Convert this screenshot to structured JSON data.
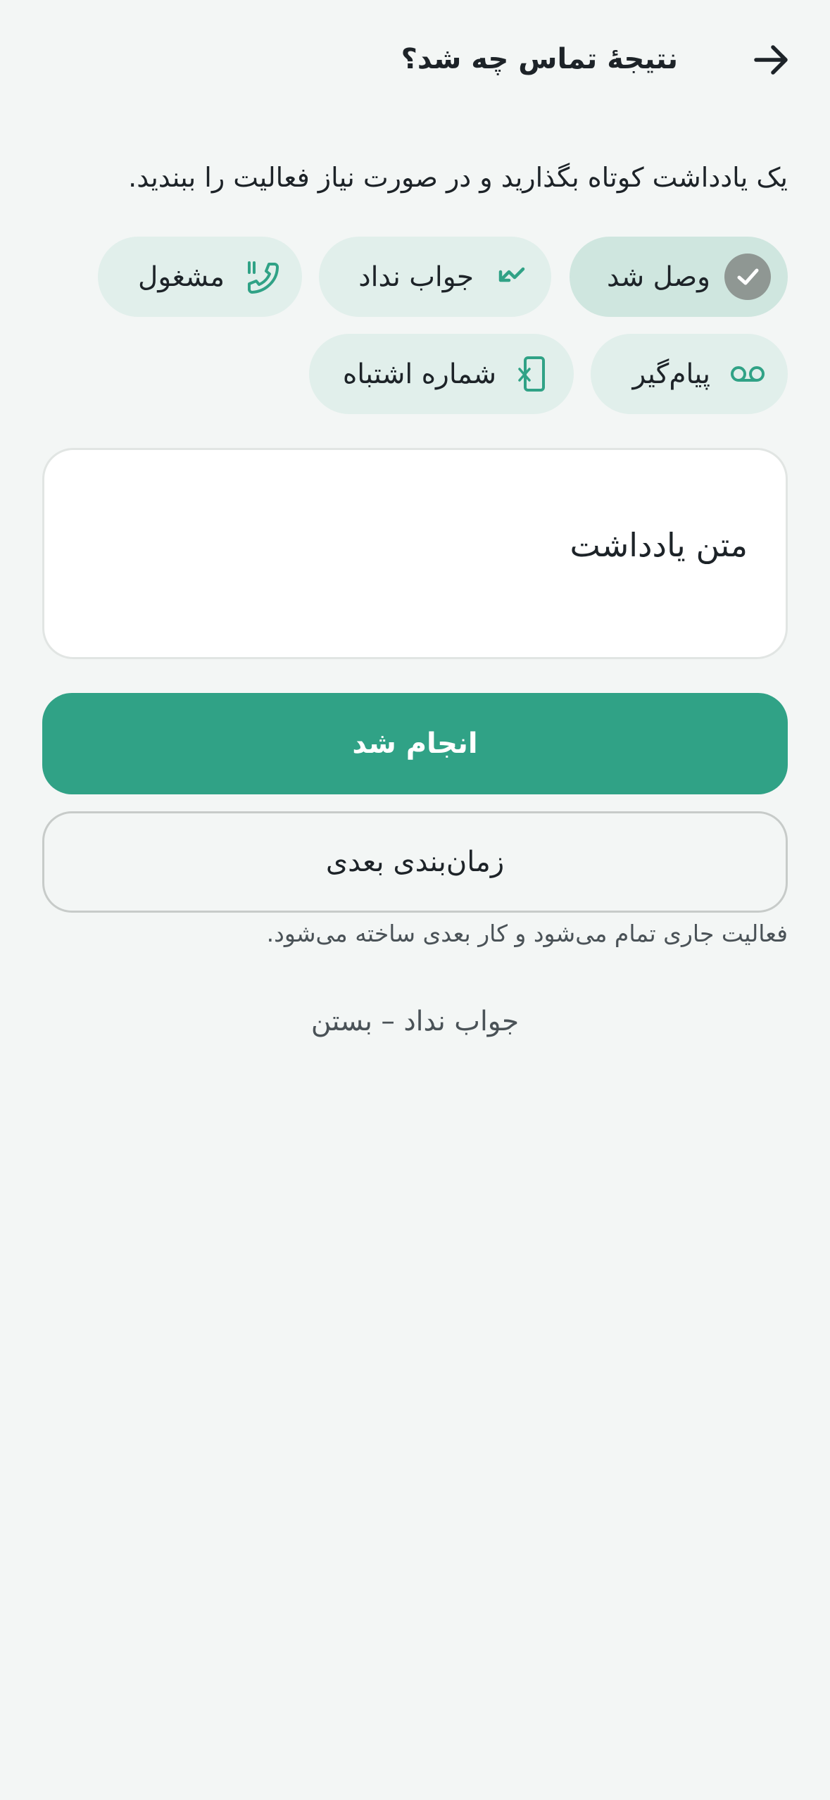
{
  "header": {
    "title": "نتیجهٔ تماس چه شد؟",
    "back_icon": "arrow-right-icon"
  },
  "subtitle": "یک یادداشت کوتاه بگذارید و در صورت نیاز فعالیت را ببندید.",
  "outcomes": [
    {
      "label": "وصل شد",
      "icon": "check-circle-icon",
      "selected": true
    },
    {
      "label": "جواب نداد",
      "icon": "missed-call-icon",
      "selected": false
    },
    {
      "label": "مشغول",
      "icon": "phone-busy-icon",
      "selected": false
    },
    {
      "label": "پیام‌گیر",
      "icon": "voicemail-icon",
      "selected": false
    },
    {
      "label": "شماره اشتباه",
      "icon": "phone-x-icon",
      "selected": false
    }
  ],
  "note": {
    "placeholder": "متن یادداشت",
    "value": ""
  },
  "actions": {
    "done_label": "انجام شد",
    "schedule_next_label": "زمان‌بندی بعدی",
    "helper_text": "فعالیت جاری تمام می‌شود و کار بعدی ساخته می‌شود.",
    "close_label": "جواب نداد – بستن"
  },
  "colors": {
    "accent": "#30a286",
    "chip_bg": "#e1efeb",
    "chip_selected_bg": "#cfe6df",
    "background": "#f3f6f5"
  }
}
